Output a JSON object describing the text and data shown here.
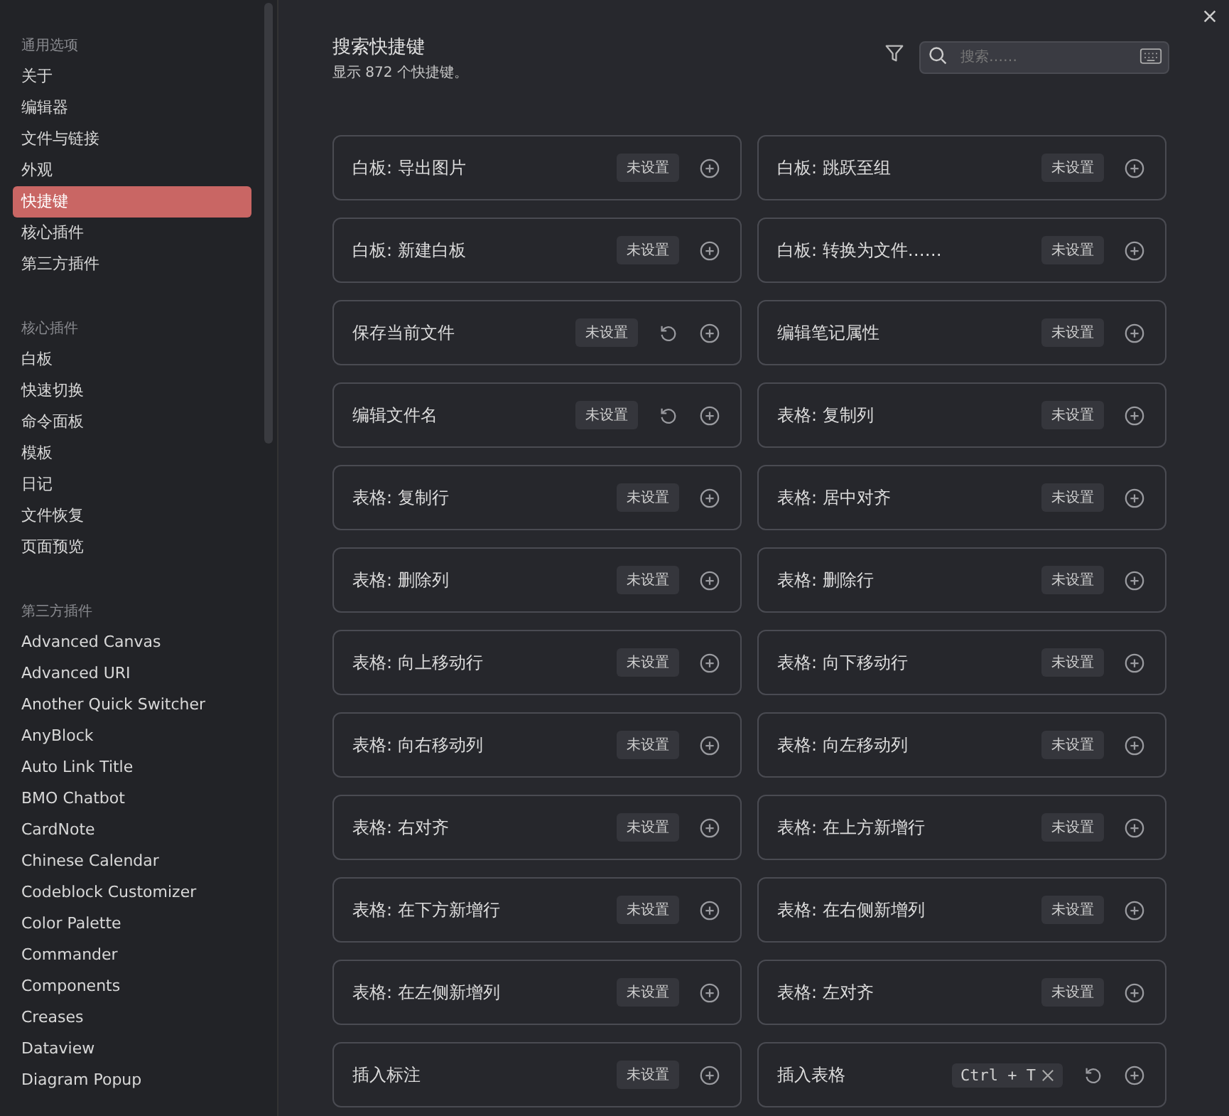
{
  "sidebar": {
    "groups": [
      {
        "heading": "通用选项",
        "items": [
          {
            "label": "关于",
            "selected": false
          },
          {
            "label": "编辑器",
            "selected": false
          },
          {
            "label": "文件与链接",
            "selected": false
          },
          {
            "label": "外观",
            "selected": false
          },
          {
            "label": "快捷键",
            "selected": true
          },
          {
            "label": "核心插件",
            "selected": false
          },
          {
            "label": "第三方插件",
            "selected": false
          }
        ]
      },
      {
        "heading": "核心插件",
        "items": [
          {
            "label": "白板",
            "selected": false
          },
          {
            "label": "快速切换",
            "selected": false
          },
          {
            "label": "命令面板",
            "selected": false
          },
          {
            "label": "模板",
            "selected": false
          },
          {
            "label": "日记",
            "selected": false
          },
          {
            "label": "文件恢复",
            "selected": false
          },
          {
            "label": "页面预览",
            "selected": false
          }
        ]
      },
      {
        "heading": "第三方插件",
        "items": [
          {
            "label": "Advanced Canvas",
            "selected": false
          },
          {
            "label": "Advanced URI",
            "selected": false
          },
          {
            "label": "Another Quick Switcher",
            "selected": false
          },
          {
            "label": "AnyBlock",
            "selected": false
          },
          {
            "label": "Auto Link Title",
            "selected": false
          },
          {
            "label": "BMO Chatbot",
            "selected": false
          },
          {
            "label": "CardNote",
            "selected": false
          },
          {
            "label": "Chinese Calendar",
            "selected": false
          },
          {
            "label": "Codeblock Customizer",
            "selected": false
          },
          {
            "label": "Color Palette",
            "selected": false
          },
          {
            "label": "Commander",
            "selected": false
          },
          {
            "label": "Components",
            "selected": false
          },
          {
            "label": "Creases",
            "selected": false
          },
          {
            "label": "Dataview",
            "selected": false
          },
          {
            "label": "Diagram Popup",
            "selected": false
          }
        ]
      }
    ]
  },
  "header": {
    "title": "搜索快捷键",
    "subtitle": "显示 872 个快捷键。"
  },
  "search": {
    "placeholder": "搜索……"
  },
  "hotkeys": [
    {
      "label": "白板: 导出图片",
      "kind": "unset",
      "hotkey": "未设置",
      "reset": false
    },
    {
      "label": "白板: 跳跃至组",
      "kind": "unset",
      "hotkey": "未设置",
      "reset": false
    },
    {
      "label": "白板: 新建白板",
      "kind": "unset",
      "hotkey": "未设置",
      "reset": false
    },
    {
      "label": "白板: 转换为文件……",
      "kind": "unset",
      "hotkey": "未设置",
      "reset": false
    },
    {
      "label": "保存当前文件",
      "kind": "unset",
      "hotkey": "未设置",
      "reset": true
    },
    {
      "label": "编辑笔记属性",
      "kind": "unset",
      "hotkey": "未设置",
      "reset": false
    },
    {
      "label": "编辑文件名",
      "kind": "unset",
      "hotkey": "未设置",
      "reset": true
    },
    {
      "label": "表格: 复制列",
      "kind": "unset",
      "hotkey": "未设置",
      "reset": false
    },
    {
      "label": "表格: 复制行",
      "kind": "unset",
      "hotkey": "未设置",
      "reset": false
    },
    {
      "label": "表格: 居中对齐",
      "kind": "unset",
      "hotkey": "未设置",
      "reset": false
    },
    {
      "label": "表格: 删除列",
      "kind": "unset",
      "hotkey": "未设置",
      "reset": false
    },
    {
      "label": "表格: 删除行",
      "kind": "unset",
      "hotkey": "未设置",
      "reset": false
    },
    {
      "label": "表格: 向上移动行",
      "kind": "unset",
      "hotkey": "未设置",
      "reset": false
    },
    {
      "label": "表格: 向下移动行",
      "kind": "unset",
      "hotkey": "未设置",
      "reset": false
    },
    {
      "label": "表格: 向右移动列",
      "kind": "unset",
      "hotkey": "未设置",
      "reset": false
    },
    {
      "label": "表格: 向左移动列",
      "kind": "unset",
      "hotkey": "未设置",
      "reset": false
    },
    {
      "label": "表格: 右对齐",
      "kind": "unset",
      "hotkey": "未设置",
      "reset": false
    },
    {
      "label": "表格: 在上方新增行",
      "kind": "unset",
      "hotkey": "未设置",
      "reset": false
    },
    {
      "label": "表格: 在下方新增行",
      "kind": "unset",
      "hotkey": "未设置",
      "reset": false
    },
    {
      "label": "表格: 在右侧新增列",
      "kind": "unset",
      "hotkey": "未设置",
      "reset": false
    },
    {
      "label": "表格: 在左侧新增列",
      "kind": "unset",
      "hotkey": "未设置",
      "reset": false
    },
    {
      "label": "表格: 左对齐",
      "kind": "unset",
      "hotkey": "未设置",
      "reset": false
    },
    {
      "label": "插入标注",
      "kind": "unset",
      "hotkey": "未设置",
      "reset": false
    },
    {
      "label": "插入表格",
      "kind": "key",
      "hotkey": "Ctrl + T",
      "reset": true
    }
  ]
}
